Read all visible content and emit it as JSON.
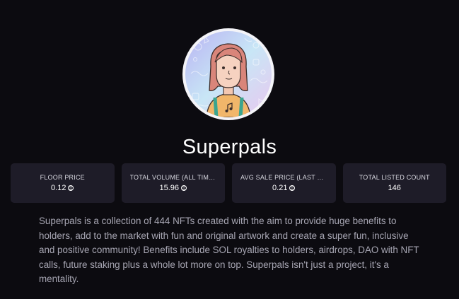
{
  "collection": {
    "name": "Superpals",
    "description": "Superpals is a collection of 444 NFTs created with the aim to provide huge benefits to holders, add to the market with fun and original artwork and create a super fun, inclusive and positive community! Benefits include SOL royalties to holders, airdrops, DAO with NFT calls, future staking plus a whole lot more on top. Superpals isn't just a project, it's a mentality."
  },
  "stats": [
    {
      "label": "FLOOR PRICE",
      "value": "0.12",
      "currency_icon": "solana-icon"
    },
    {
      "label": "TOTAL VOLUME (ALL TIME...",
      "value": "15.96",
      "currency_icon": "solana-icon"
    },
    {
      "label": "AVG SALE PRICE (LAST 24...",
      "value": "0.21",
      "currency_icon": "solana-icon"
    },
    {
      "label": "TOTAL LISTED COUNT",
      "value": "146"
    }
  ]
}
